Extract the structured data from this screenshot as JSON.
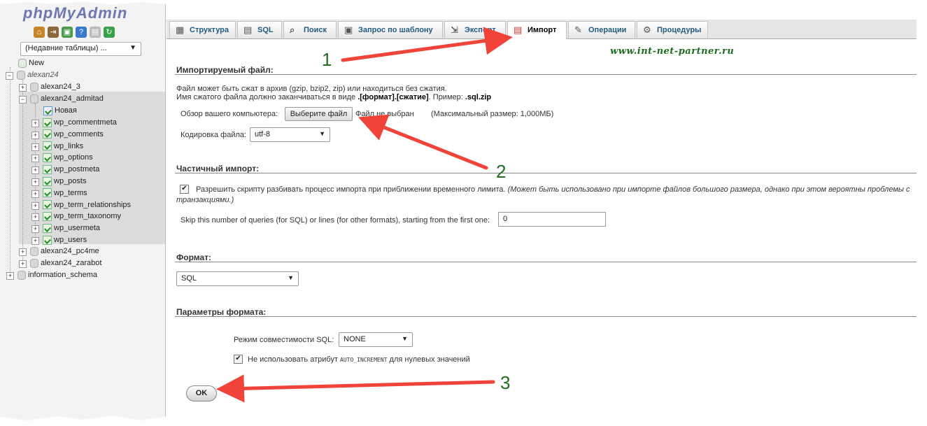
{
  "sidebar": {
    "logo_text": "phpMyAdmin",
    "quick_icons": [
      "home-icon",
      "exit-icon",
      "query-icon",
      "help-icon",
      "docs-icon",
      "reload-icon"
    ],
    "recent_tables": "(Недавние таблицы) ...",
    "tree": {
      "new": "New",
      "server": "alexan24",
      "databases": [
        {
          "name": "alexan24_3"
        },
        {
          "name": "alexan24_admitad",
          "expanded": true,
          "new_table": "Новая",
          "tables": [
            "wp_commentmeta",
            "wp_comments",
            "wp_links",
            "wp_options",
            "wp_postmeta",
            "wp_posts",
            "wp_terms",
            "wp_term_relationships",
            "wp_term_taxonomy",
            "wp_usermeta",
            "wp_users"
          ]
        },
        {
          "name": "alexan24_pc4me"
        },
        {
          "name": "alexan24_zarabot"
        }
      ],
      "info_schema": "information_schema"
    }
  },
  "tabs": [
    {
      "label": "Структура",
      "icon": "structure-icon"
    },
    {
      "label": "SQL",
      "icon": "sql-icon"
    },
    {
      "label": "Поиск",
      "icon": "search-icon"
    },
    {
      "label": "Запрос по шаблону",
      "icon": "query-icon"
    },
    {
      "label": "Экспорт",
      "icon": "export-icon"
    },
    {
      "label": "Импорт",
      "icon": "import-icon",
      "active": true
    },
    {
      "label": "Операции",
      "icon": "wrench-icon"
    },
    {
      "label": "Процедуры",
      "icon": "routines-icon"
    }
  ],
  "watermark": "www.int-net-partner.ru",
  "import_file": {
    "title": "Импортируемый файл:",
    "note1": "Файл может быть сжат в архив (gzip, bzip2, zip) или находиться без сжатия.",
    "note2_pre": "Имя сжатого файла должно заканчиваться в виде ",
    "note2_fmt": ".[формат].[сжатие]",
    "note2_mid": ". Пример: ",
    "note2_example": ".sql.zip",
    "browse_label": "Обзор вашего компьютера:",
    "choose_button": "Выберите файл",
    "no_file": "Файл не выбран",
    "max_size": "(Максимальный размер: 1,000МБ)",
    "charset_label": "Кодировка файла:",
    "charset_value": "utf-8"
  },
  "partial_import": {
    "title": "Частичный импорт:",
    "allow_interrupt_label": "Разрешить скрипту разбивать процесс импорта при приближении временного лимита.",
    "allow_interrupt_note": "(Может быть использовано при импорте файлов большого размера, однако при этом вероятны проблемы с",
    "allow_interrupt_note2": "транзакциями.)",
    "allow_interrupt_checked": true,
    "skip_label": "Skip this number of queries (for SQL) or lines (for other formats), starting from the first one:",
    "skip_value": "0"
  },
  "format": {
    "title": "Формат:",
    "value": "SQL"
  },
  "format_options": {
    "title": "Параметры формата:",
    "compat_label": "Режим совместимости SQL:",
    "compat_value": "NONE",
    "no_auto_inc_pre": "Не использовать атрибут",
    "no_auto_inc_code": "AUTO_INCREMENT",
    "no_auto_inc_post": "для нулевых значений",
    "no_auto_inc_checked": true
  },
  "ok_button": "OK",
  "annotations": {
    "n1": "1",
    "n2": "2",
    "n3": "3",
    "arrow_color": "#f0443a",
    "number_color": "#1f6e1f"
  }
}
